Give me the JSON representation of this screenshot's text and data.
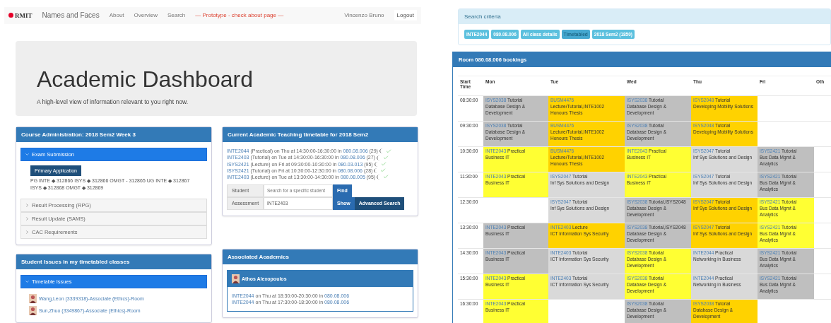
{
  "left": {
    "navbar": {
      "logo": "RMIT",
      "brand": "Names and Faces",
      "links": [
        "About",
        "Overview",
        "Search"
      ],
      "notice": "— Prototype - check about page —",
      "user": "Vincenzo Bruno",
      "logout": "Logout"
    },
    "jumbotron": {
      "title": "Academic Dashboard",
      "subtitle": "A high-level view of information relevant to you right now."
    },
    "course_admin": {
      "title": "Course Administration: 2018 Sem2 Week 3",
      "sections": [
        {
          "label": "Exam Submission",
          "expanded": true,
          "button": "Primary Application",
          "text": "PG INTE ◆ 312866 ISYS ◆ 312866 OMGT - 312865 UG INTE ◆ 312867 ISYS ◆ 312868 OMGT ◆ 312869"
        },
        {
          "label": "Result Processing (RPG)",
          "expanded": false
        },
        {
          "label": "Result Update (SAMS)",
          "expanded": false
        },
        {
          "label": "CAC Requirements",
          "expanded": false
        }
      ]
    },
    "student_issues": {
      "title": "Student Issues in my timetabled classes",
      "section": {
        "label": "Timetable Issues",
        "expanded": true
      },
      "people": [
        "Wang,Leon (3339318)-Associate (Ethics)-Room",
        "Sun,Zhuo (3349867)-Associate (Ethics)-Room"
      ]
    },
    "teaching": {
      "title": "Current Academic Teaching timetable for 2018 Sem2",
      "classes": [
        {
          "code": "INTE2044",
          "text": "(Practical) on Thu at 14:30:00-16:30:00 in",
          "room": "080.08.006",
          "count": "(29)"
        },
        {
          "code": "INTE2403",
          "text": "(Tutorial) on Tue at 14:30:00-16:30:00 in",
          "room": "080.08.006",
          "count": "(27)"
        },
        {
          "code": "ISYS2421",
          "text": "(Lecture) on Fri at 09:30:00-10:30:00 in",
          "room": "080.03.013",
          "count": "(95)"
        },
        {
          "code": "ISYS2421",
          "text": "(Tutorial) on Fri at 10:30:00-12:30:00 in",
          "room": "080.08.006",
          "count": "(28)"
        },
        {
          "code": "INTE2403",
          "text": "(Lecture) on Tue at 13:30:00-14:30:00 in",
          "room": "080.08.005",
          "count": "(95)"
        }
      ],
      "student": {
        "label": "Student",
        "placeholder": "Search for a specific student",
        "button": "Find"
      },
      "assessment": {
        "label": "Assessment",
        "value": "INTE2403",
        "button": "Show",
        "advanced": "Advanced Search"
      }
    },
    "academics": {
      "title": "Associated Academics",
      "person": "Athos Alexopoulos",
      "classes": [
        {
          "code": "INTE2044",
          "text": "on Thu at 18:30:00-20:30:00 in",
          "room": "080.08.006"
        },
        {
          "code": "INTE2044",
          "text": "on Thu at 17:30:00-18:30:00 in",
          "room": "080.08.006"
        }
      ]
    }
  },
  "right": {
    "search_criteria": {
      "title": "Search criteria",
      "tags": [
        {
          "label": "INTE2044",
          "selected": false
        },
        {
          "label": "080.08.006",
          "selected": false
        },
        {
          "label": "All class details",
          "selected": false
        },
        {
          "label": "Timetabled",
          "selected": true
        },
        {
          "label": "2018 Sem2 (1850)",
          "selected": false
        }
      ]
    },
    "bookings": {
      "title": "Room 080.08.006 bookings",
      "columns": [
        "Start Time",
        "Mon",
        "Tue",
        "Wed",
        "Thu",
        "Fri",
        "Oth"
      ],
      "rows": [
        [
          "08:30:00",
          {
            "code": "ISYS2038",
            "label": "Tutorial",
            "title": "Database Design & Development",
            "color": "#bfbfbf"
          },
          {
            "code": "BUSM4476",
            "title": "Lecture/Tutorial,INTE1002 Honours Thesis",
            "color": "#ffd200"
          },
          {
            "code": "ISYS2038",
            "label": "Tutorial",
            "title": "Database Design & Development",
            "color": "#bfbfbf"
          },
          {
            "code": "ISYS2048",
            "label": "Tutorial",
            "title": "Developing Mobility Solutions",
            "color": "#ffd200"
          },
          "",
          ""
        ],
        [
          "09:30:00",
          {
            "code": "ISYS2038",
            "label": "Tutorial",
            "title": "Database Design & Development",
            "color": "#bfbfbf"
          },
          {
            "code": "BUSM4476",
            "title": "Lecture/Tutorial,INTE1002 Honours Thesis",
            "color": "#ffd200"
          },
          {
            "code": "ISYS2038",
            "label": "Tutorial",
            "title": "Database Design & Development",
            "color": "#bfbfbf"
          },
          {
            "code": "ISYS2048",
            "label": "Tutorial",
            "title": "Developing Mobility Solutions",
            "color": "#ffd200"
          },
          "",
          ""
        ],
        [
          "10:30:00",
          {
            "code": "INTE2043",
            "label": "Practical",
            "title": "Business IT",
            "color": "#ffff33"
          },
          {
            "code": "BUSM4476",
            "title": "Lecture/Tutorial,INTE1002 Honours Thesis",
            "color": "#ffd200"
          },
          {
            "code": "INTE2043",
            "label": "Practical",
            "title": "Business IT",
            "color": "#ffff33"
          },
          {
            "code": "ISYS2047",
            "label": "Tutorial",
            "title": "Inf Sys Solutions and Design",
            "color": "#d9d9d9"
          },
          {
            "code": "ISYS2421",
            "label": "Tutorial",
            "title": "Bus Data Mgmt & Analytics",
            "color": "#bfbfbf"
          },
          ""
        ],
        [
          "11:30:00",
          {
            "code": "INTE2043",
            "label": "Practical",
            "title": "Business IT",
            "color": "#ffff33"
          },
          {
            "code": "ISYS2047",
            "label": "Tutorial",
            "title": "Inf Sys Solutions and Design",
            "color": "#d9d9d9"
          },
          {
            "code": "INTE2043",
            "label": "Practical",
            "title": "Business IT",
            "color": "#ffff33"
          },
          {
            "code": "ISYS2047",
            "label": "Tutorial",
            "title": "Inf Sys Solutions and Design",
            "color": "#d9d9d9"
          },
          {
            "code": "ISYS2421",
            "label": "Tutorial",
            "title": "Bus Data Mgmt & Analytics",
            "color": "#bfbfbf"
          },
          ""
        ],
        [
          "12:30:00",
          "",
          {
            "code": "ISYS2047",
            "label": "Tutorial",
            "title": "Inf Sys Solutions and Design",
            "color": "#d9d9d9"
          },
          {
            "code": "ISYS2038",
            "label": "Tutorial,ISYS2048",
            "title": "Database Design & Development",
            "color": "#bfbfbf"
          },
          {
            "code": "ISYS2047",
            "label": "Tutorial",
            "title": "Inf Sys Solutions and Design",
            "color": "#ffd200"
          },
          {
            "code": "ISYS2421",
            "label": "Tutorial",
            "title": "Bus Data Mgmt & Analytics",
            "color": "#ffff33"
          },
          ""
        ],
        [
          "13:30:00",
          {
            "code": "INTE2043",
            "label": "Practical",
            "title": "Business IT",
            "color": "#bfbfbf"
          },
          {
            "code": "INTE2403",
            "label": "Lecture",
            "title": "ICT Information Sys Security",
            "color": "#ffd200"
          },
          {
            "code": "ISYS2038",
            "label": "Tutorial,ISYS2048",
            "title": "Database Design & Development",
            "color": "#bfbfbf"
          },
          {
            "code": "ISYS2047",
            "label": "Tutorial",
            "title": "Inf Sys Solutions and Design",
            "color": "#ffd200"
          },
          {
            "code": "ISYS2421",
            "label": "Tutorial",
            "title": "Bus Data Mgmt & Analytics",
            "color": "#ffff33"
          },
          ""
        ],
        [
          "14:30:00",
          {
            "code": "INTE2043",
            "label": "Practical",
            "title": "Business IT",
            "color": "#bfbfbf"
          },
          {
            "code": "INTE2403",
            "label": "Tutorial",
            "title": "ICT Information Sys Security",
            "color": "#d9d9d9"
          },
          {
            "code": "ISYS2038",
            "label": "Tutorial",
            "title": "Database Design & Development",
            "color": "#ffff33"
          },
          {
            "code": "INTE2044",
            "label": "Practical",
            "title": "Networking in Business",
            "color": "#d9d9d9"
          },
          {
            "code": "ISYS2421",
            "label": "Tutorial",
            "title": "Bus Data Mgmt & Analytics",
            "color": "#bfbfbf"
          },
          ""
        ],
        [
          "15:30:00",
          {
            "code": "INTE2043",
            "label": "Practical",
            "title": "Business IT",
            "color": "#ffff33"
          },
          {
            "code": "INTE2403",
            "label": "Tutorial",
            "title": "ICT Information Sys Security",
            "color": "#d9d9d9"
          },
          {
            "code": "ISYS2038",
            "label": "Tutorial",
            "title": "Database Design & Development",
            "color": "#ffff33"
          },
          {
            "code": "INTE2044",
            "label": "Practical",
            "title": "Networking in Business",
            "color": "#d9d9d9"
          },
          {
            "code": "ISYS2421",
            "label": "Tutorial",
            "title": "Bus Data Mgmt & Analytics",
            "color": "#bfbfbf"
          },
          ""
        ],
        [
          "16:30:00",
          {
            "code": "INTE2043",
            "label": "Practical",
            "title": "Business IT",
            "color": "#ffff33"
          },
          "",
          {
            "code": "ISYS2038",
            "label": "Tutorial",
            "title": "Database Design & Development",
            "color": "#bfbfbf"
          },
          {
            "code": "ISYS2038",
            "label": "Tutorial",
            "title": "Database Design & Development",
            "color": "#ffd200"
          },
          "",
          ""
        ]
      ]
    }
  }
}
